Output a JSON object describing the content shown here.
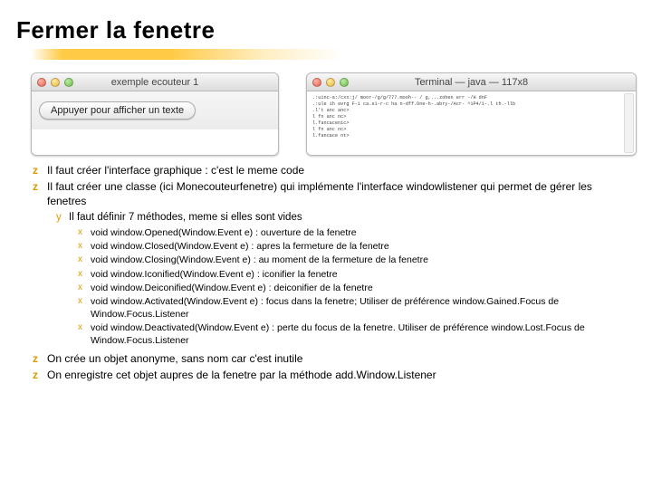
{
  "title": "Fermer la fenetre",
  "window_left": {
    "title": "exemple ecouteur 1",
    "button": "Appuyer pour afficher un texte"
  },
  "window_right": {
    "title": "Terminal — java — 117x8",
    "lines": [
      ".:uinc-a:/cxx:j/  moor-/g/g/777.mooh-- / g,...zohen err -/H dnF",
      ".:ule ih avrg F-1 ca.s1-r-c ha n-dff.Dne-h-.abry-/Acr- ^1P4/1-.l th.-llb",
      ".l't anc anc>",
      "l fn anc nc>",
      "l.fancacenic>",
      "l fn anc nc>",
      "l.fancace nt>"
    ]
  },
  "bullets": {
    "z1": "Il faut créer l'interface graphique : c'est le meme code",
    "z2": "Il faut créer une classe (ici Monecouteurfenetre) qui implémente l'interface windowlistener qui permet de gérer les fenetres",
    "y1": "Il faut définir 7 méthodes, meme si elles sont vides",
    "x1": "void window.Opened(Window.Event e) : ouverture de la fenetre",
    "x2": "void window.Closed(Window.Event e) : apres la fermeture de la fenetre",
    "x3": "void window.Closing(Window.Event e) : au moment de la fermeture de la fenetre",
    "x4": "void window.Iconified(Window.Event e) : iconifier la fenetre",
    "x5": "void window.Deiconified(Window.Event e) : deiconifier de la fenetre",
    "x6": "void window.Activated(Window.Event e) : focus dans la fenetre; Utiliser de préférence window.Gained.Focus de Window.Focus.Listener",
    "x7": "void window.Deactivated(Window.Event e) : perte du focus de la fenetre. Utiliser de préférence window.Lost.Focus de Window.Focus.Listener",
    "z3": "On crée un objet anonyme, sans nom car c'est inutile",
    "z4": "On enregistre cet objet aupres de la fenetre par la méthode add.Window.Listener"
  }
}
